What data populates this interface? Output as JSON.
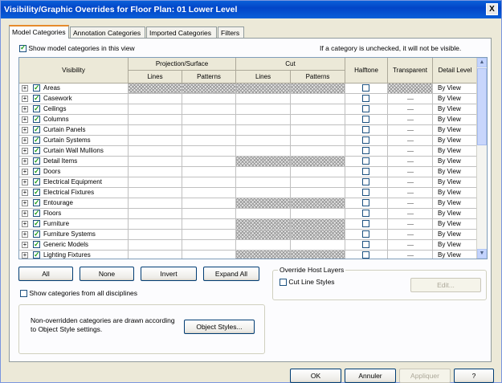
{
  "window": {
    "title": "Visibility/Graphic Overrides for Floor Plan: 01 Lower Level",
    "close_glyph": "X"
  },
  "tabs": [
    {
      "label": "Model Categories",
      "active": true
    },
    {
      "label": "Annotation Categories",
      "active": false
    },
    {
      "label": "Imported Categories",
      "active": false
    },
    {
      "label": "Filters",
      "active": false
    }
  ],
  "show_model_categories": {
    "label": "Show model categories in this view",
    "checked": true
  },
  "hint_text": "If a category is unchecked, it will not be visible.",
  "table": {
    "headers": {
      "visibility": "Visibility",
      "projection": "Projection/Surface",
      "lines": "Lines",
      "patterns": "Patterns",
      "cut": "Cut",
      "cut_lines": "Lines",
      "cut_patterns": "Patterns",
      "halftone": "Halftone",
      "transparent": "Transparent",
      "detail_level": "Detail Level"
    },
    "rows": [
      {
        "name": "Areas",
        "checked": true,
        "detail": "By View",
        "selected": true
      },
      {
        "name": "Casework",
        "checked": true,
        "detail": "By View"
      },
      {
        "name": "Ceilings",
        "checked": true,
        "detail": "By View"
      },
      {
        "name": "Columns",
        "checked": true,
        "detail": "By View"
      },
      {
        "name": "Curtain Panels",
        "checked": true,
        "detail": "By View"
      },
      {
        "name": "Curtain Systems",
        "checked": true,
        "detail": "By View"
      },
      {
        "name": "Curtain Wall Mullions",
        "checked": true,
        "detail": "By View"
      },
      {
        "name": "Detail Items",
        "checked": true,
        "detail": "By View"
      },
      {
        "name": "Doors",
        "checked": true,
        "detail": "By View"
      },
      {
        "name": "Electrical Equipment",
        "checked": true,
        "detail": "By View"
      },
      {
        "name": "Electrical Fixtures",
        "checked": true,
        "detail": "By View"
      },
      {
        "name": "Entourage",
        "checked": true,
        "detail": "By View"
      },
      {
        "name": "Floors",
        "checked": true,
        "detail": "By View"
      },
      {
        "name": "Furniture",
        "checked": true,
        "detail": "By View"
      },
      {
        "name": "Furniture Systems",
        "checked": true,
        "detail": "By View"
      },
      {
        "name": "Generic Models",
        "checked": true,
        "detail": "By View"
      },
      {
        "name": "Lighting Fixtures",
        "checked": true,
        "detail": "By View"
      }
    ]
  },
  "buttons": {
    "all": "All",
    "none": "None",
    "invert": "Invert",
    "expand_all": "Expand All",
    "object_styles": "Object Styles...",
    "edit": "Edit...",
    "ok": "OK",
    "cancel": "Annuler",
    "apply": "Appliquer",
    "help": "?"
  },
  "override_host_layers": {
    "title": "Override Host Layers",
    "cut_line_styles": "Cut Line Styles",
    "checked": false
  },
  "show_all_disciplines": {
    "label": "Show categories from all disciplines",
    "checked": false
  },
  "note": {
    "line1": "Non-overridden categories are drawn according",
    "line2": "to Object Style settings."
  },
  "colors": {
    "title_bar": "#0a5fd8",
    "dialog_bg": "#ece9d8",
    "panel_bg": "#fcfcfe",
    "grid_border": "#7f9db9"
  }
}
